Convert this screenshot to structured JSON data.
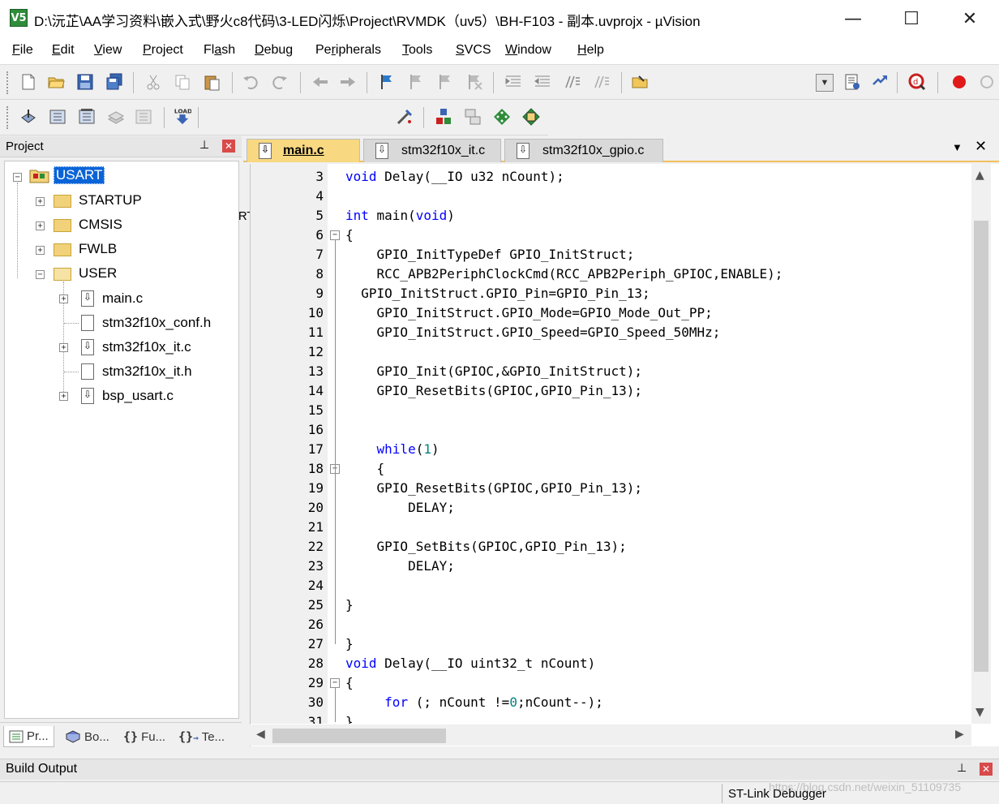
{
  "window": {
    "title": "D:\\沅芷\\AA学习资料\\嵌入式\\野火c8代码\\3-LED闪烁\\Project\\RVMDK（uv5）\\BH-F103 - 副本.uvprojx - µVision",
    "app_icon_label": "V5",
    "minimize": "—",
    "maximize": "☐",
    "close": "✕"
  },
  "menu": [
    {
      "pre": "",
      "u": "F",
      "post": "ile"
    },
    {
      "pre": "",
      "u": "E",
      "post": "dit"
    },
    {
      "pre": "",
      "u": "V",
      "post": "iew"
    },
    {
      "pre": "",
      "u": "P",
      "post": "roject"
    },
    {
      "pre": "Fl",
      "u": "a",
      "post": "sh"
    },
    {
      "pre": "",
      "u": "D",
      "post": "ebug"
    },
    {
      "pre": "Pe",
      "u": "r",
      "post": "ipherals"
    },
    {
      "pre": "",
      "u": "T",
      "post": "ools"
    },
    {
      "pre": "",
      "u": "S",
      "post": "VCS"
    },
    {
      "pre": "",
      "u": "W",
      "post": "indow"
    },
    {
      "pre": "",
      "u": "H",
      "post": "elp"
    }
  ],
  "target": {
    "value": "USART"
  },
  "project_panel": {
    "title": "Project",
    "tree": {
      "root": "USART",
      "groups": [
        "STARTUP",
        "CMSIS",
        "FWLB",
        "USER"
      ],
      "user_files": [
        "main.c",
        "stm32f10x_conf.h",
        "stm32f10x_it.c",
        "stm32f10x_it.h",
        "bsp_usart.c"
      ]
    },
    "bottom_tabs": [
      "Pr...",
      "Bo...",
      "Fu...",
      "Te..."
    ]
  },
  "editor": {
    "tabs": [
      "main.c",
      "stm32f10x_it.c",
      "stm32f10x_gpio.c"
    ],
    "active_tab": "main.c",
    "lines": [
      {
        "n": "3",
        "code": "void Delay(__IO u32 nCount);"
      },
      {
        "n": "4",
        "code": ""
      },
      {
        "n": "5",
        "code": "int main(void)"
      },
      {
        "n": "6",
        "code": "{"
      },
      {
        "n": "7",
        "code": "    GPIO_InitTypeDef GPIO_InitStruct;"
      },
      {
        "n": "8",
        "code": "    RCC_APB2PeriphClockCmd(RCC_APB2Periph_GPIOC,ENABLE);"
      },
      {
        "n": "9",
        "code": "  GPIO_InitStruct.GPIO_Pin=GPIO_Pin_13;"
      },
      {
        "n": "10",
        "code": "    GPIO_InitStruct.GPIO_Mode=GPIO_Mode_Out_PP;"
      },
      {
        "n": "11",
        "code": "    GPIO_InitStruct.GPIO_Speed=GPIO_Speed_50MHz;"
      },
      {
        "n": "12",
        "code": ""
      },
      {
        "n": "13",
        "code": "    GPIO_Init(GPIOC,&GPIO_InitStruct);"
      },
      {
        "n": "14",
        "code": "    GPIO_ResetBits(GPIOC,GPIO_Pin_13);"
      },
      {
        "n": "15",
        "code": ""
      },
      {
        "n": "16",
        "code": ""
      },
      {
        "n": "17",
        "code": "    while(1)"
      },
      {
        "n": "18",
        "code": "    {"
      },
      {
        "n": "19",
        "code": "    GPIO_ResetBits(GPIOC,GPIO_Pin_13);"
      },
      {
        "n": "20",
        "code": "        DELAY;"
      },
      {
        "n": "21",
        "code": ""
      },
      {
        "n": "22",
        "code": "    GPIO_SetBits(GPIOC,GPIO_Pin_13);"
      },
      {
        "n": "23",
        "code": "        DELAY;"
      },
      {
        "n": "24",
        "code": ""
      },
      {
        "n": "25",
        "code": "}"
      },
      {
        "n": "26",
        "code": ""
      },
      {
        "n": "27",
        "code": "}"
      },
      {
        "n": "28",
        "code": "void Delay(__IO uint32_t nCount)"
      },
      {
        "n": "29",
        "code": "{"
      },
      {
        "n": "30",
        "code": "     for (; nCount !=0;nCount--);"
      },
      {
        "n": "31",
        "code": "}"
      }
    ]
  },
  "build_output": {
    "title": "Build Output"
  },
  "status_bar": {
    "debugger": "ST-Link Debugger"
  },
  "watermark": "https://blog.csdn.net/weixin_51109735",
  "colors": {
    "keyword": "#0000ff",
    "number": "#008080",
    "active_tab": "#f8d880",
    "tab_underline": "#f2c15c"
  }
}
